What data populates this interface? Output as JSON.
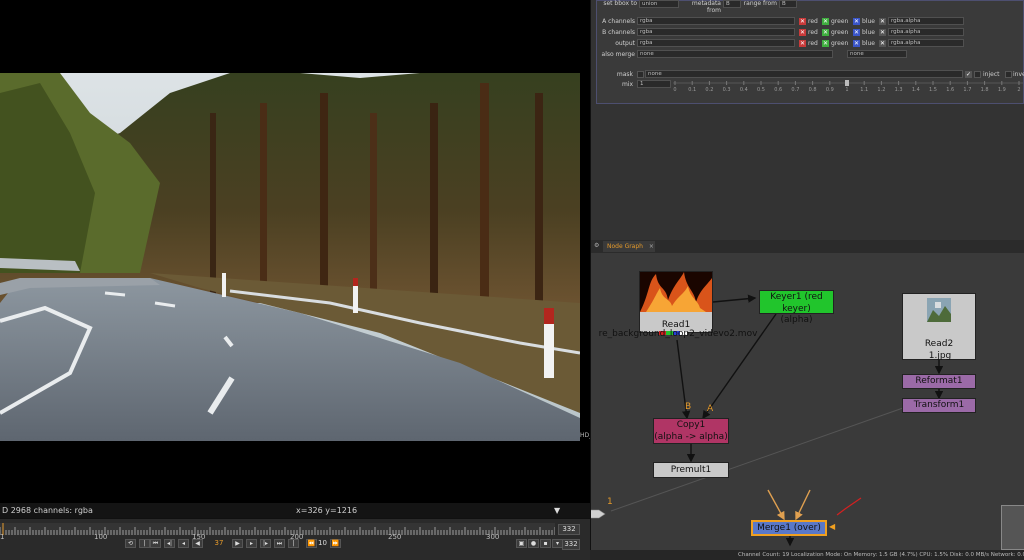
{
  "viewer": {
    "format_info": "D 2968 channels: rgba",
    "coords": "x=326 y=1216",
    "hd_label": "HD_"
  },
  "timeline": {
    "ruler_labels": [
      "1",
      "100",
      "150",
      "200",
      "250",
      "300"
    ],
    "end_frame": "332",
    "current_frame": "37",
    "step": "10",
    "last_frame": "332"
  },
  "properties": {
    "set_bbox_label": "set bbox to",
    "set_bbox_value": "union",
    "metadata_from_label": "metadata from",
    "metadata_from_value": "B",
    "range_from_label": "range from",
    "range_from_value": "B",
    "rows": [
      {
        "label": "A channels",
        "value": "rgba",
        "alpha": "rgba.alpha"
      },
      {
        "label": "B channels",
        "value": "rgba",
        "alpha": "rgba.alpha"
      },
      {
        "label": "output",
        "value": "rgba",
        "alpha": "rgba.alpha"
      }
    ],
    "also_merge_label": "also merge",
    "also_merge_value": "none",
    "also_merge_value2": "none",
    "channel_red": "red",
    "channel_green": "green",
    "channel_blue": "blue",
    "mask_label": "mask",
    "mask_value": "none",
    "inject_label": "inject",
    "invert_label": "inver",
    "mix_label": "mix",
    "mix_value": "1",
    "mix_ticks": [
      "0",
      "0.1",
      "0.2",
      "0.3",
      "0.4",
      "0.5",
      "0.6",
      "0.7",
      "0.8",
      "0.9",
      "1",
      "1.1",
      "1.2",
      "1.3",
      "1.4",
      "1.5",
      "1.6",
      "1.7",
      "1.8",
      "1.9",
      "2"
    ]
  },
  "node_graph": {
    "tab_label": "Node Graph",
    "nodes": {
      "read1": {
        "title": "Read1",
        "file": "re_background_loop2_videvo2.mov"
      },
      "keyer1": {
        "title": "Keyer1 (red keyer)",
        "sub": "(alpha)"
      },
      "read2": {
        "title": "Read2",
        "file": "1.jpg"
      },
      "reformat1": {
        "title": "Reformat1"
      },
      "transform1": {
        "title": "Transform1"
      },
      "copy1": {
        "title": "Copy1",
        "sub": "(alpha -> alpha)"
      },
      "premult1": {
        "title": "Premult1"
      },
      "merge1": {
        "title": "Merge1 (over)"
      }
    },
    "input_b": "B",
    "input_a": "A",
    "dot_label": "1"
  },
  "status_bar": "Channel Count: 19  Localization Mode: On  Memory: 1.5 GB (4.7%)  CPU: 1.5%  Disk: 0.0 MB/s  Network: 0.0",
  "colors": {
    "keyer": "#21c52c",
    "read": "#c9c9c9",
    "copy": "#b03565",
    "transform": "#9b6aa7",
    "merge_border": "#f0a020",
    "accent": "#e59a2b"
  }
}
